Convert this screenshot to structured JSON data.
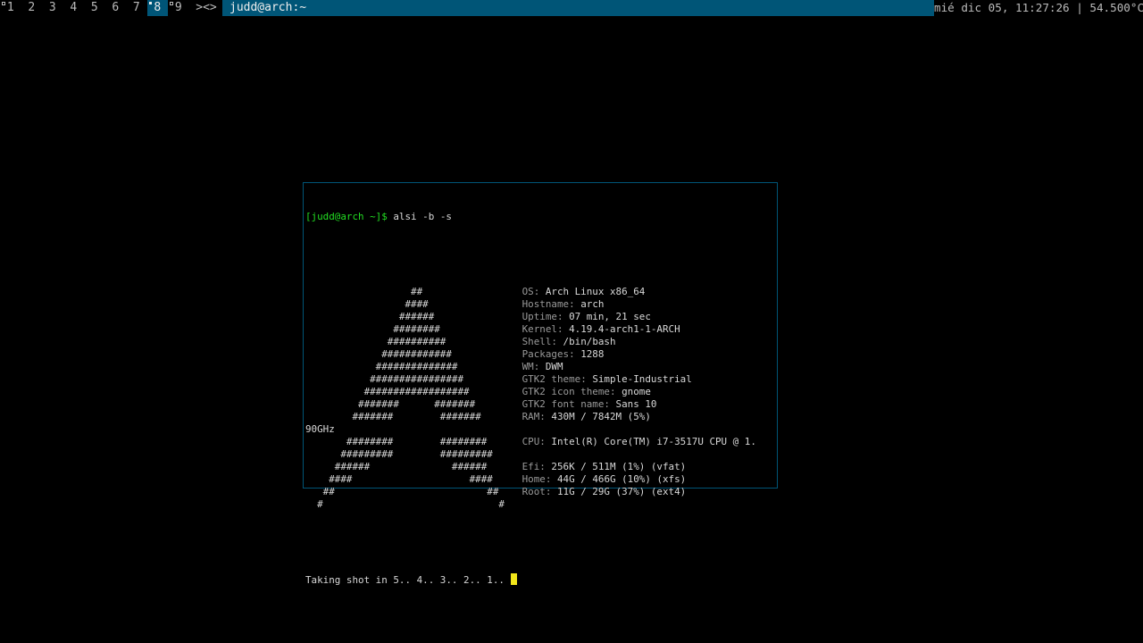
{
  "bar": {
    "tags": [
      {
        "label": "1",
        "occupied": true,
        "selected": false
      },
      {
        "label": "2",
        "occupied": false,
        "selected": false
      },
      {
        "label": "3",
        "occupied": false,
        "selected": false
      },
      {
        "label": "4",
        "occupied": false,
        "selected": false
      },
      {
        "label": "5",
        "occupied": false,
        "selected": false
      },
      {
        "label": "6",
        "occupied": false,
        "selected": false
      },
      {
        "label": "7",
        "occupied": false,
        "selected": false
      },
      {
        "label": "8",
        "occupied": true,
        "selected": true
      },
      {
        "label": "9",
        "occupied": true,
        "selected": false
      }
    ],
    "layout_symbol": "><>",
    "window_title": "judd@arch:~",
    "status": "mié dic 05, 11:27:26 | 54.500°C"
  },
  "terminal": {
    "prompt": "[judd@arch ~]$",
    "command": "alsi -b -s",
    "ascii_logo": [
      "                  ##",
      "                 ####",
      "                ######",
      "               ########",
      "              ##########",
      "             ############",
      "            ##############",
      "           ################",
      "          ##################",
      "         #######      #######",
      "        #######        #######",
      "",
      "       ########        ########",
      "      #########        #########",
      "     ######              ######",
      "    ####                    ####",
      "   ##                          ##",
      "  #                              #"
    ],
    "info": [
      {
        "label": "OS:",
        "value": "Arch Linux x86_64"
      },
      {
        "label": "Hostname:",
        "value": "arch"
      },
      {
        "label": "Uptime:",
        "value": "07 min, 21 sec"
      },
      {
        "label": "Kernel:",
        "value": "4.19.4-arch1-1-ARCH"
      },
      {
        "label": "Shell:",
        "value": "/bin/bash"
      },
      {
        "label": "Packages:",
        "value": "1288"
      },
      {
        "label": "WM:",
        "value": "DWM"
      },
      {
        "label": "GTK2 theme:",
        "value": "Simple-Industrial"
      },
      {
        "label": "GTK2 icon theme:",
        "value": "gnome"
      },
      {
        "label": "GTK2 font name:",
        "value": "Sans 10"
      },
      {
        "label": "RAM:",
        "value": "430M / 7842M (5%)"
      },
      {
        "label": "CPU:",
        "value": "Intel(R) Core(TM) i7-3517U CPU @ 1."
      },
      {
        "label": "",
        "value": ""
      },
      {
        "label": "Efi:",
        "value": "256K / 511M (1%) (vfat)"
      },
      {
        "label": "Home:",
        "value": "44G / 466G (10%) (xfs)"
      },
      {
        "label": "Root:",
        "value": "11G / 29G (37%) (ext4)"
      }
    ],
    "cpu_wrap": "90GHz",
    "output": "Taking shot in 5.. 4.. 3.. 2.. 1.. "
  },
  "colors": {
    "bar_selected": "#005577",
    "prompt": "#22dd22",
    "cursor": "#f2e61a",
    "foreground": "#d8d8d8"
  }
}
